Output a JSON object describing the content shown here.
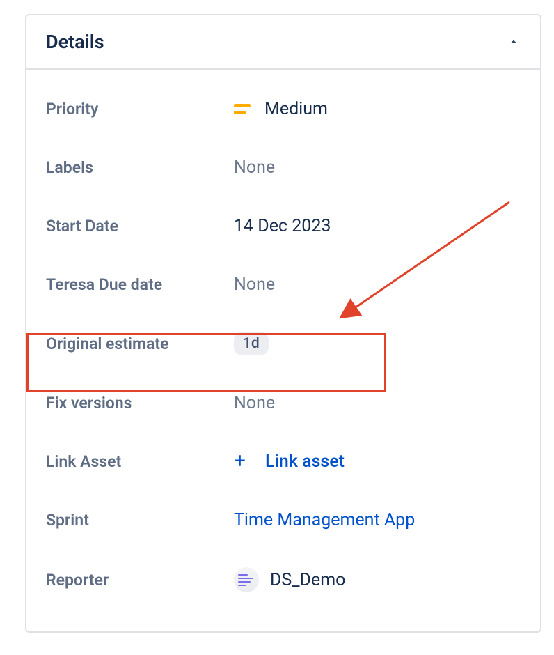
{
  "panel": {
    "title": "Details"
  },
  "fields": {
    "priority": {
      "label": "Priority",
      "value": "Medium"
    },
    "labels": {
      "label": "Labels",
      "value": "None"
    },
    "start_date": {
      "label": "Start Date",
      "value": "14 Dec 2023"
    },
    "due_date": {
      "label": "Teresa Due date",
      "value": "None"
    },
    "original_estimate": {
      "label": "Original estimate",
      "value": "1d"
    },
    "fix_versions": {
      "label": "Fix versions",
      "value": "None"
    },
    "link_asset": {
      "label": "Link Asset",
      "action": "Link asset"
    },
    "sprint": {
      "label": "Sprint",
      "value": "Time Management App"
    },
    "reporter": {
      "label": "Reporter",
      "value": "DS_Demo"
    }
  }
}
